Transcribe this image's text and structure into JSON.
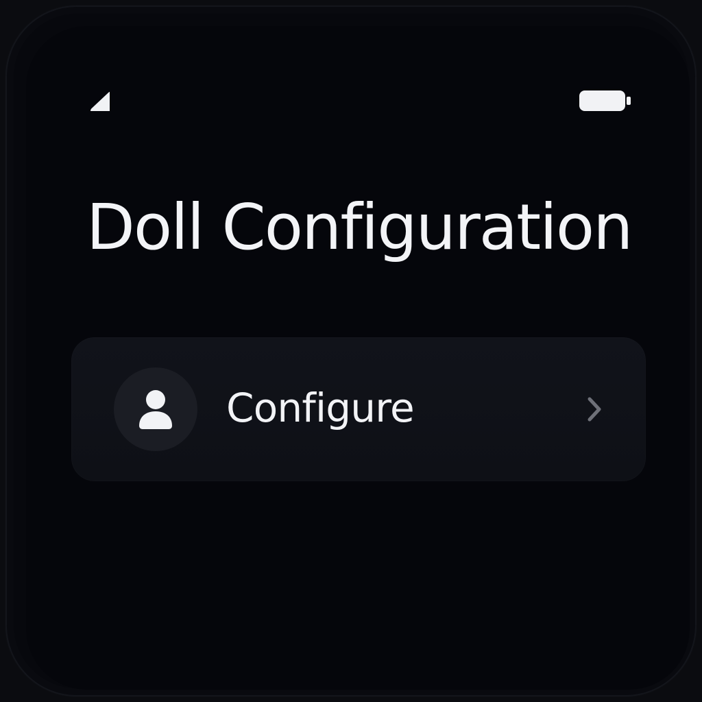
{
  "screen": {
    "title": "Doll Configuration"
  },
  "status_bar": {
    "icons": [
      "signal-icon",
      "battery-icon"
    ]
  },
  "settings_item": {
    "label": "Configure",
    "icon_name": "user-icon",
    "trailing_icon": "chevron-right-icon"
  },
  "colors": {
    "background": "#05060B",
    "card": "#10121A",
    "primary_text": "#F2F3F6",
    "secondary_icon": "#6E7078",
    "avatar_background": "#1B1D24"
  }
}
